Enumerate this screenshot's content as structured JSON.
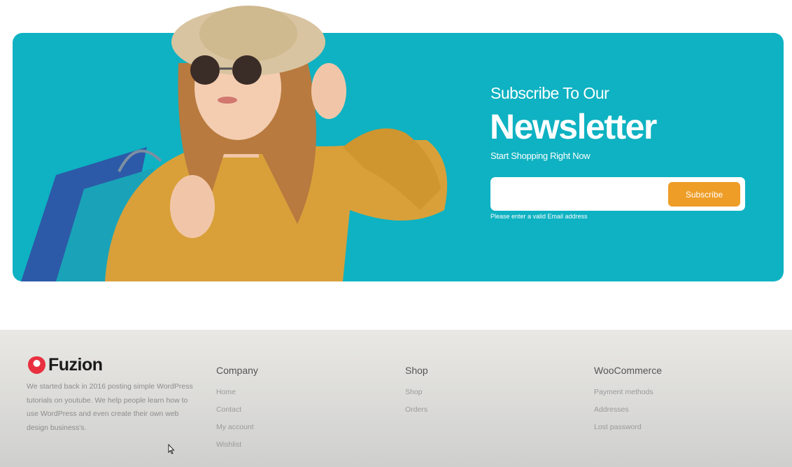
{
  "newsletter": {
    "subheading": "Subscribe To Our",
    "heading": "Newsletter",
    "tagline": "Start Shopping Right Now",
    "email_placeholder": "",
    "button_label": "Subscribe",
    "hint": "Please enter a valid Email address"
  },
  "footer": {
    "brand": "Fuzion",
    "about": "We started back in 2016 posting simple WordPress tutorials on youtube. We help people learn how to use WordPress and even create their own web design business's.",
    "columns": [
      {
        "title": "Company",
        "links": [
          "Home",
          "Contact",
          "My account",
          "Wishlist"
        ]
      },
      {
        "title": "Shop",
        "links": [
          "Shop",
          "Orders"
        ]
      },
      {
        "title": "WooCommerce",
        "links": [
          "Payment methods",
          "Addresses",
          "Lost password"
        ]
      }
    ]
  },
  "colors": {
    "banner": "#0eb2c2",
    "button": "#ee9d27",
    "brand_icon": "#e8303f"
  },
  "icons": [
    "fuzion-logo-icon",
    "mouse-cursor-icon"
  ]
}
